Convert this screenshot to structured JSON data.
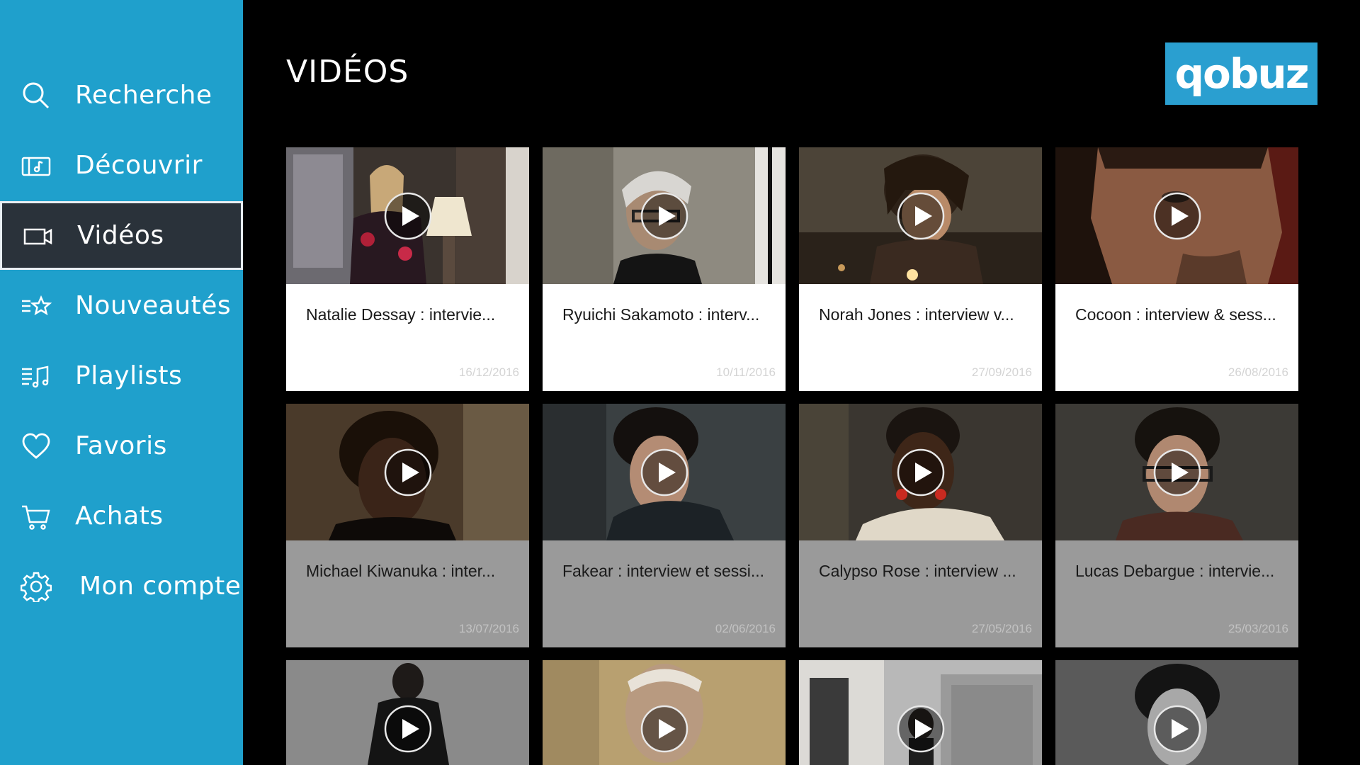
{
  "header": {
    "title": "VIDÉOS",
    "logo_text": "qobuz"
  },
  "sidebar": {
    "items": [
      {
        "label": "Recherche",
        "icon": "search-icon"
      },
      {
        "label": "Découvrir",
        "icon": "discover-icon"
      },
      {
        "label": "Vidéos",
        "icon": "video-camera-icon"
      },
      {
        "label": "Nouveautés",
        "icon": "new-releases-icon"
      },
      {
        "label": "Playlists",
        "icon": "playlist-icon"
      },
      {
        "label": "Favoris",
        "icon": "heart-icon"
      },
      {
        "label": "Achats",
        "icon": "cart-icon"
      },
      {
        "label": "Mon compte",
        "icon": "gear-icon"
      }
    ]
  },
  "videos": [
    {
      "title": "Natalie Dessay : intervie...",
      "date": "16/12/2016"
    },
    {
      "title": "Ryuichi Sakamoto : interv...",
      "date": "10/11/2016"
    },
    {
      "title": "Norah Jones : interview v...",
      "date": "27/09/2016"
    },
    {
      "title": "Cocoon : interview & sess...",
      "date": "26/08/2016"
    },
    {
      "title": "Michael Kiwanuka : inter...",
      "date": "13/07/2016"
    },
    {
      "title": "Fakear : interview et sessi...",
      "date": "02/06/2016"
    },
    {
      "title": "Calypso Rose : interview ...",
      "date": "27/05/2016"
    },
    {
      "title": "Lucas Debargue : intervie...",
      "date": "25/03/2016"
    }
  ],
  "colors": {
    "sidebar_bg": "#1fa0cc",
    "active_bg": "#2a323a",
    "logo_bg": "#2a9fd0"
  }
}
